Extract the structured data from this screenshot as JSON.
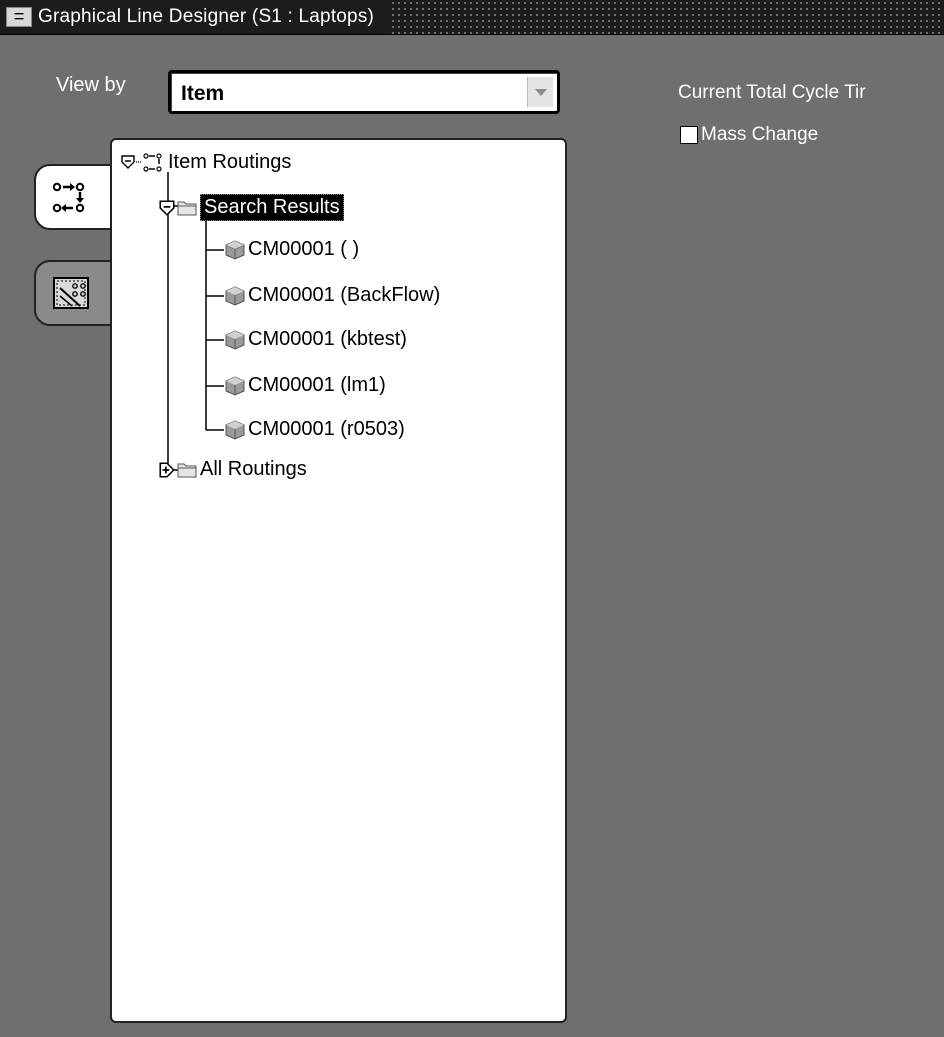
{
  "window": {
    "title": "Graphical Line Designer (S1 : Laptops)"
  },
  "view_by": {
    "label": "View by",
    "value": "Item"
  },
  "side_tabs": [
    {
      "name": "routing-tree-tab",
      "active": true
    },
    {
      "name": "diagram-tab",
      "active": false
    }
  ],
  "tree": {
    "root": {
      "label": "Item Routings",
      "expanded": true
    },
    "search_results": {
      "label": "Search Results",
      "expanded": true,
      "selected": true
    },
    "routings": [
      {
        "label": "CM00001 ( )"
      },
      {
        "label": "CM00001 (BackFlow)"
      },
      {
        "label": "CM00001 (kbtest)"
      },
      {
        "label": "CM00001 (lm1)"
      },
      {
        "label": "CM00001 (r0503)"
      }
    ],
    "all_routings": {
      "label": "All Routings",
      "expanded": false
    }
  },
  "right_panel": {
    "cycle_time_label": "Current Total Cycle Tir",
    "mass_change_label": "Mass Change",
    "mass_change_checked": false
  },
  "colors": {
    "background": "#6f6f6f",
    "titlebar": "#1c1c1c",
    "tree_bg": "#ffffff",
    "selection": "#000000"
  }
}
